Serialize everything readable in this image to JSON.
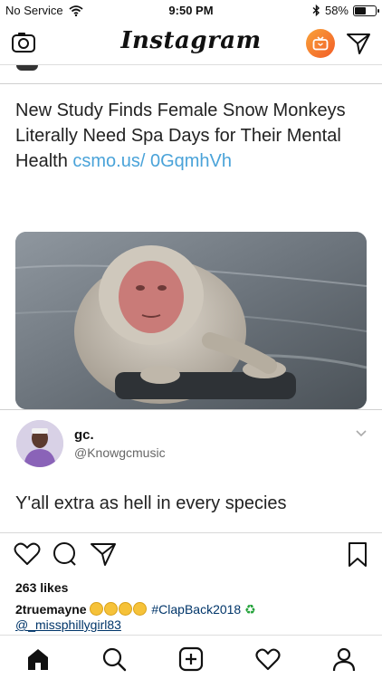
{
  "status_bar": {
    "carrier": "No Service",
    "time": "9:50 PM",
    "battery": "58%",
    "battery_level": 0.58
  },
  "header": {
    "title": "Instagram"
  },
  "post": {
    "tweet": {
      "text": "New Study Finds Female Snow Monkeys Literally Need Spa Days for Their Mental Health",
      "link": "csmo.us/ 0GqmhVh"
    },
    "reply": {
      "name": "gc.",
      "handle": "@Knowgcmusic",
      "text": "Y'all extra as hell in every species"
    },
    "likes": "263 likes",
    "caption": {
      "username": "2truemayne",
      "hashtag": "#ClapBack2018",
      "mention": "@_missphillygirl83"
    }
  },
  "icons": {
    "camera": "camera-icon",
    "igtv": "igtv-icon",
    "direct": "direct-message-icon",
    "like": "heart-icon",
    "comment": "comment-icon",
    "share": "share-icon",
    "save": "bookmark-icon",
    "home": "home-icon",
    "search": "search-icon",
    "add": "add-post-icon",
    "activity": "heart-icon",
    "profile": "profile-icon"
  }
}
